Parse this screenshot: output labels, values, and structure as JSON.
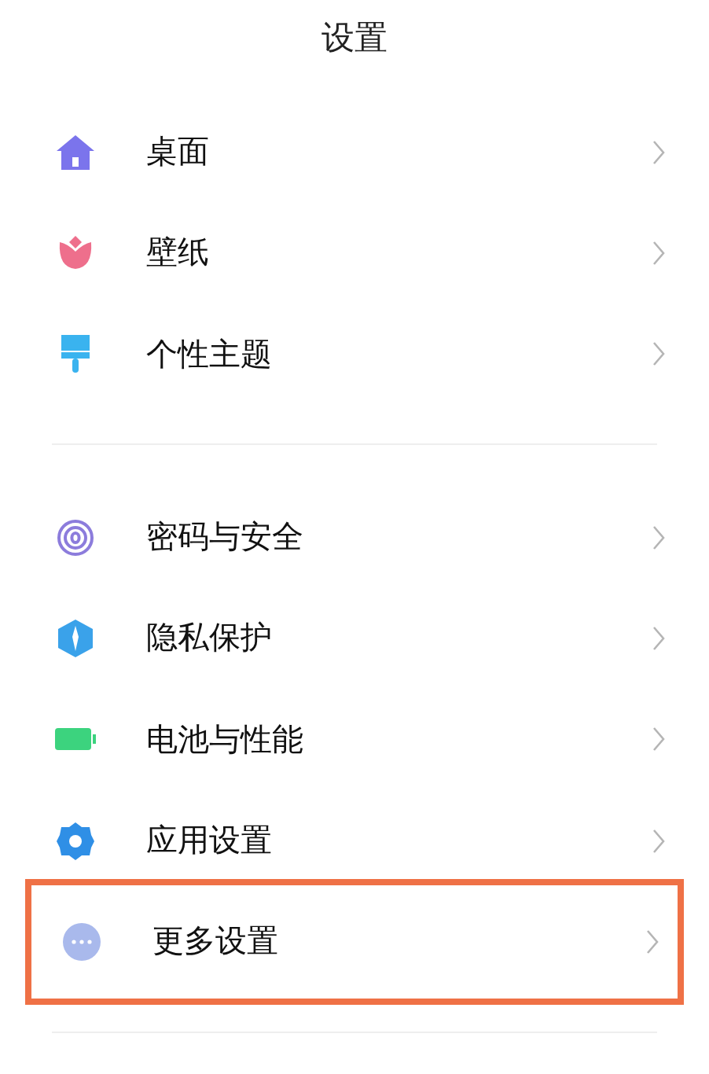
{
  "title": "设置",
  "sections": [
    {
      "items": [
        {
          "kind": "home",
          "label": "桌面",
          "highlighted": false
        },
        {
          "kind": "tulip",
          "label": "壁纸",
          "highlighted": false
        },
        {
          "kind": "brush",
          "label": "个性主题",
          "highlighted": false
        }
      ]
    },
    {
      "items": [
        {
          "kind": "fingerprint",
          "label": "密码与安全",
          "highlighted": false
        },
        {
          "kind": "shield",
          "label": "隐私保护",
          "highlighted": false
        },
        {
          "kind": "battery",
          "label": "电池与性能",
          "highlighted": false
        },
        {
          "kind": "gear",
          "label": "应用设置",
          "highlighted": false
        },
        {
          "kind": "more",
          "label": "更多设置",
          "highlighted": true
        }
      ]
    }
  ]
}
